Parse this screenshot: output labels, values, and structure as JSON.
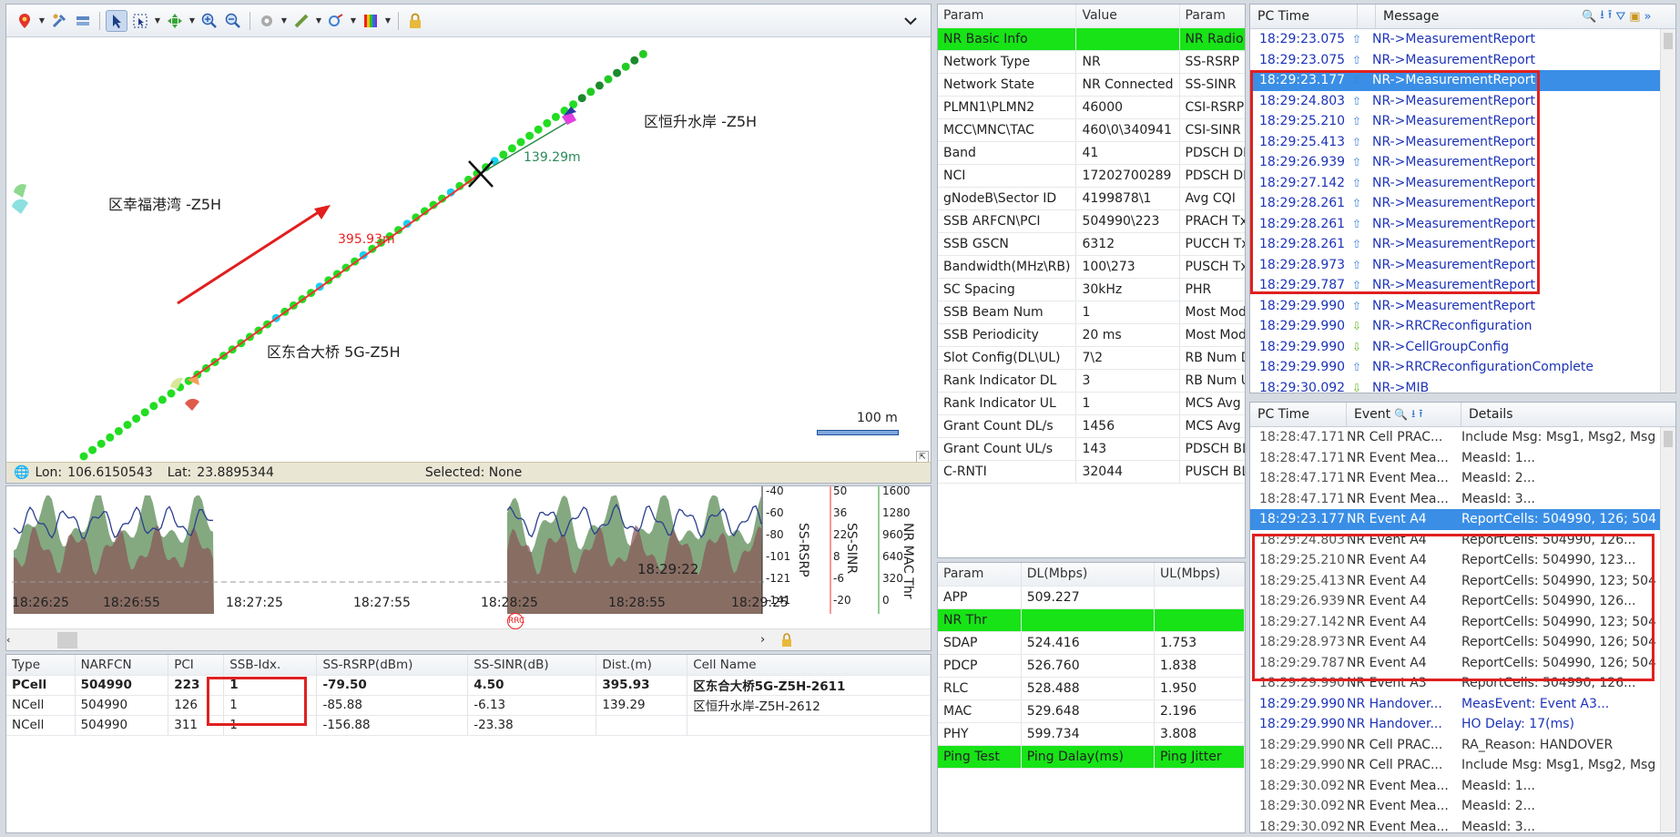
{
  "map": {
    "status": {
      "lon_label": "Lon:",
      "lon": "106.6150543",
      "lat_label": "Lat:",
      "lat": "23.8895344",
      "selected": "Selected: None"
    },
    "labels": [
      {
        "text": "区恒升水岸 -Z5H"
      },
      {
        "text": "区幸福港湾 -Z5H"
      },
      {
        "text": "区东合大桥 5G-Z5H"
      }
    ],
    "distances": {
      "green": "139.29m",
      "red": "395.93m"
    },
    "scale": "100 m"
  },
  "chart": {
    "x_ticks": [
      "18:26:25",
      "18:26:55",
      "18:27:25",
      "18:27:55",
      "18:28:25",
      "18:28:55",
      "18:29:25"
    ],
    "cursor_time": "18:29:22",
    "axes": [
      {
        "name": "SS-RSRP",
        "ticks": [
          "-40",
          "-60",
          "-80",
          "-101",
          "-121",
          "-141"
        ]
      },
      {
        "name": "SS-SINR",
        "ticks": [
          "50",
          "36",
          "22",
          "8",
          "-6",
          "-20"
        ]
      },
      {
        "name": "NR MAC Thr",
        "ticks": [
          "1600",
          "1280",
          "960",
          "640",
          "320",
          "0"
        ]
      }
    ],
    "marker": "RRC"
  },
  "cell_table": {
    "headers": [
      "Type",
      "NARFCN",
      "PCI",
      "SSB-Idx.",
      "SS-RSRP(dBm)",
      "SS-SINR(dB)",
      "Dist.(m)",
      "Cell Name"
    ],
    "rows": [
      [
        "PCell",
        "504990",
        "223",
        "1",
        "-79.50",
        "4.50",
        "395.93",
        "区东合大桥5G-Z5H-2611"
      ],
      [
        "NCell",
        "504990",
        "126",
        "1",
        "-85.88",
        "-6.13",
        "139.29",
        "区恒升水岸-Z5H-2612"
      ],
      [
        "NCell",
        "504990",
        "311",
        "1",
        "-156.88",
        "-23.38",
        "",
        ""
      ]
    ]
  },
  "params": {
    "headers": [
      "Param",
      "Value",
      "Param"
    ],
    "rows": [
      [
        "NR Basic Info",
        "",
        "NR Radio Inf"
      ],
      [
        "Network Type",
        "NR",
        "SS-RSRP"
      ],
      [
        "Network State",
        "NR Connected",
        "SS-SINR"
      ],
      [
        "PLMN1\\PLMN2",
        "46000",
        "CSI-RSRP"
      ],
      [
        "MCC\\MNC\\TAC",
        "460\\0\\340941",
        "CSI-SINR"
      ],
      [
        "Band",
        "41",
        "PDSCH DM-R"
      ],
      [
        "NCI",
        "17202700289",
        "PDSCH DM-S"
      ],
      [
        "gNodeB\\Sector ID",
        "4199878\\1",
        "Avg CQI"
      ],
      [
        "SSB ARFCN\\PCI",
        "504990\\223",
        "PRACH TxPo"
      ],
      [
        "SSB GSCN",
        "6312",
        "PUCCH TxPo"
      ],
      [
        "Bandwidth(MHz\\RB)",
        "100\\273",
        "PUSCH TxPo"
      ],
      [
        "SC Spacing",
        "30kHz",
        "PHR"
      ],
      [
        "SSB Beam Num",
        "1",
        "Most Modul"
      ],
      [
        "SSB Periodicity",
        "20 ms",
        "Most Modul"
      ],
      [
        "Slot Config(DL\\UL)",
        "7\\2",
        "RB Num DL/"
      ],
      [
        "Rank Indicator DL",
        "3",
        "RB Num UL/"
      ],
      [
        "Rank Indicator UL",
        "1",
        "MCS Avg DL"
      ],
      [
        "Grant Count DL/s",
        "1456",
        "MCS Avg UL"
      ],
      [
        "Grant Count UL/s",
        "143",
        "PDSCH BLER"
      ],
      [
        "C-RNTI",
        "32044",
        "PUSCH BLER"
      ]
    ]
  },
  "throughput": {
    "headers": [
      "Param",
      "DL(Mbps)",
      "UL(Mbps)"
    ],
    "rows": [
      [
        "APP",
        "509.227",
        ""
      ],
      [
        "NR Thr",
        "",
        ""
      ],
      [
        "SDAP",
        "524.416",
        "1.753"
      ],
      [
        "PDCP",
        "526.760",
        "1.838"
      ],
      [
        "RLC",
        "528.488",
        "1.950"
      ],
      [
        "MAC",
        "529.648",
        "2.196"
      ],
      [
        "PHY",
        "599.734",
        "3.808"
      ],
      [
        "Ping Test",
        "Ping Dalay(ms)",
        "Ping Jitter"
      ]
    ]
  },
  "messages": {
    "headers": [
      "PC Time",
      "Message"
    ],
    "rows": [
      {
        "time": "18:29:23.075",
        "dir": "up",
        "msg": "NR->MeasurementReport"
      },
      {
        "time": "18:29:23.075",
        "dir": "up",
        "msg": "NR->MeasurementReport"
      },
      {
        "time": "18:29:23.177",
        "dir": "up",
        "msg": "NR->MeasurementReport"
      },
      {
        "time": "18:29:24.803",
        "dir": "up",
        "msg": "NR->MeasurementReport"
      },
      {
        "time": "18:29:25.210",
        "dir": "up",
        "msg": "NR->MeasurementReport"
      },
      {
        "time": "18:29:25.413",
        "dir": "up",
        "msg": "NR->MeasurementReport"
      },
      {
        "time": "18:29:26.939",
        "dir": "up",
        "msg": "NR->MeasurementReport"
      },
      {
        "time": "18:29:27.142",
        "dir": "up",
        "msg": "NR->MeasurementReport"
      },
      {
        "time": "18:29:28.261",
        "dir": "up",
        "msg": "NR->MeasurementReport"
      },
      {
        "time": "18:29:28.261",
        "dir": "up",
        "msg": "NR->MeasurementReport"
      },
      {
        "time": "18:29:28.261",
        "dir": "up",
        "msg": "NR->MeasurementReport"
      },
      {
        "time": "18:29:28.973",
        "dir": "up",
        "msg": "NR->MeasurementReport"
      },
      {
        "time": "18:29:29.787",
        "dir": "up",
        "msg": "NR->MeasurementReport"
      },
      {
        "time": "18:29:29.990",
        "dir": "up",
        "msg": "NR->MeasurementReport"
      },
      {
        "time": "18:29:29.990",
        "dir": "down",
        "msg": "NR->RRCReconfiguration"
      },
      {
        "time": "18:29:29.990",
        "dir": "down",
        "msg": "NR->CellGroupConfig"
      },
      {
        "time": "18:29:29.990",
        "dir": "up",
        "msg": "NR->RRCReconfigurationComplete"
      },
      {
        "time": "18:29:30.092",
        "dir": "down",
        "msg": "NR->MIB"
      }
    ]
  },
  "events": {
    "headers": [
      "PC Time",
      "Event",
      "Details"
    ],
    "rows": [
      {
        "time": "18:28:47.171",
        "event": "NR Cell PRAC...",
        "detail": "Include Msg: Msg1, Msg2, Msg"
      },
      {
        "time": "18:28:47.171",
        "event": "NR Event Mea...",
        "detail": "MeasId: 1..."
      },
      {
        "time": "18:28:47.171",
        "event": "NR Event Mea...",
        "detail": "MeasId: 2..."
      },
      {
        "time": "18:28:47.171",
        "event": "NR Event Mea...",
        "detail": "MeasId: 3..."
      },
      {
        "time": "18:29:23.177",
        "event": "NR Event A4",
        "detail": "ReportCells: 504990, 126; 504"
      },
      {
        "time": "18:29:24.803",
        "event": "NR Event A4",
        "detail": "ReportCells: 504990, 126..."
      },
      {
        "time": "18:29:25.210",
        "event": "NR Event A4",
        "detail": "ReportCells: 504990, 123..."
      },
      {
        "time": "18:29:25.413",
        "event": "NR Event A4",
        "detail": "ReportCells: 504990, 123; 504"
      },
      {
        "time": "18:29:26.939",
        "event": "NR Event A4",
        "detail": "ReportCells: 504990, 126..."
      },
      {
        "time": "18:29:27.142",
        "event": "NR Event A4",
        "detail": "ReportCells: 504990, 123; 504"
      },
      {
        "time": "18:29:28.973",
        "event": "NR Event A4",
        "detail": "ReportCells: 504990, 126; 504"
      },
      {
        "time": "18:29:29.787",
        "event": "NR Event A4",
        "detail": "ReportCells: 504990, 126; 504"
      },
      {
        "time": "18:29:29.990",
        "event": "NR Event A3",
        "detail": "ReportCells: 504990, 126..."
      },
      {
        "time": "18:29:29.990",
        "event": "NR Handover...",
        "detail": "MeasEvent: Event A3..."
      },
      {
        "time": "18:29:29.990",
        "event": "NR Handover...",
        "detail": "HO Delay: 17(ms)"
      },
      {
        "time": "18:29:29.990",
        "event": "NR Cell PRAC...",
        "detail": "RA_Reason: HANDOVER"
      },
      {
        "time": "18:29:29.990",
        "event": "NR Cell PRAC...",
        "detail": "Include Msg: Msg1, Msg2, Msg"
      },
      {
        "time": "18:29:30.092",
        "event": "NR Event Mea...",
        "detail": "MeasId: 1..."
      },
      {
        "time": "18:29:30.092",
        "event": "NR Event Mea...",
        "detail": "MeasId: 2..."
      },
      {
        "time": "18:29:30.092",
        "event": "NR Event Mea...",
        "detail": "MeasId: 3..."
      }
    ]
  }
}
